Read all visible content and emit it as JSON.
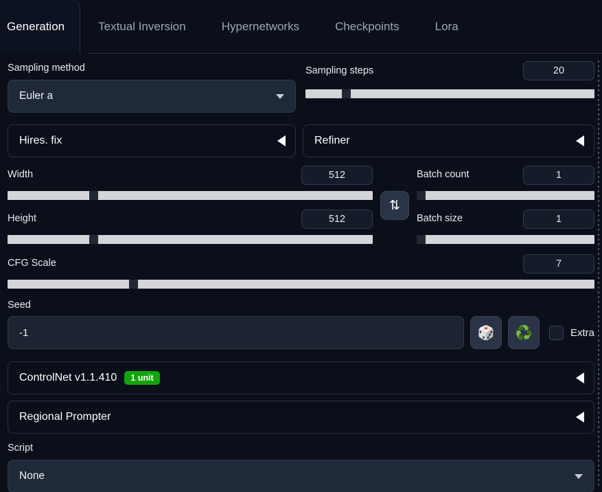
{
  "tabs": [
    {
      "label": "Generation",
      "active": true
    },
    {
      "label": "Textual Inversion",
      "active": false
    },
    {
      "label": "Hypernetworks",
      "active": false
    },
    {
      "label": "Checkpoints",
      "active": false
    },
    {
      "label": "Lora",
      "active": false
    }
  ],
  "sampling_method": {
    "label": "Sampling method",
    "value": "Euler a"
  },
  "sampling_steps": {
    "label": "Sampling steps",
    "value": "20",
    "fill_percent": 13
  },
  "hires_fix": {
    "label": "Hires. fix"
  },
  "refiner": {
    "label": "Refiner"
  },
  "width": {
    "label": "Width",
    "value": "512",
    "fill_percent": 23
  },
  "height": {
    "label": "Height",
    "value": "512",
    "fill_percent": 23
  },
  "swap_button": {
    "icon": "swap-vertical-icon",
    "glyph": "⇅"
  },
  "batch_count": {
    "label": "Batch count",
    "value": "1",
    "fill_percent": 0
  },
  "batch_size": {
    "label": "Batch size",
    "value": "1",
    "fill_percent": 0
  },
  "cfg_scale": {
    "label": "CFG Scale",
    "value": "7",
    "fill_percent": 21
  },
  "seed": {
    "label": "Seed",
    "value": "-1",
    "placeholder": "-1",
    "random_icon": "🎲",
    "reuse_icon": "♻️",
    "extra_label": "Extra",
    "extra_checked": false
  },
  "controlnet": {
    "label": "ControlNet v1.1.410",
    "badge": "1 unit",
    "badge_color": "#11a40b"
  },
  "regional_prompter": {
    "label": "Regional Prompter"
  },
  "script": {
    "label": "Script",
    "value": "None"
  }
}
